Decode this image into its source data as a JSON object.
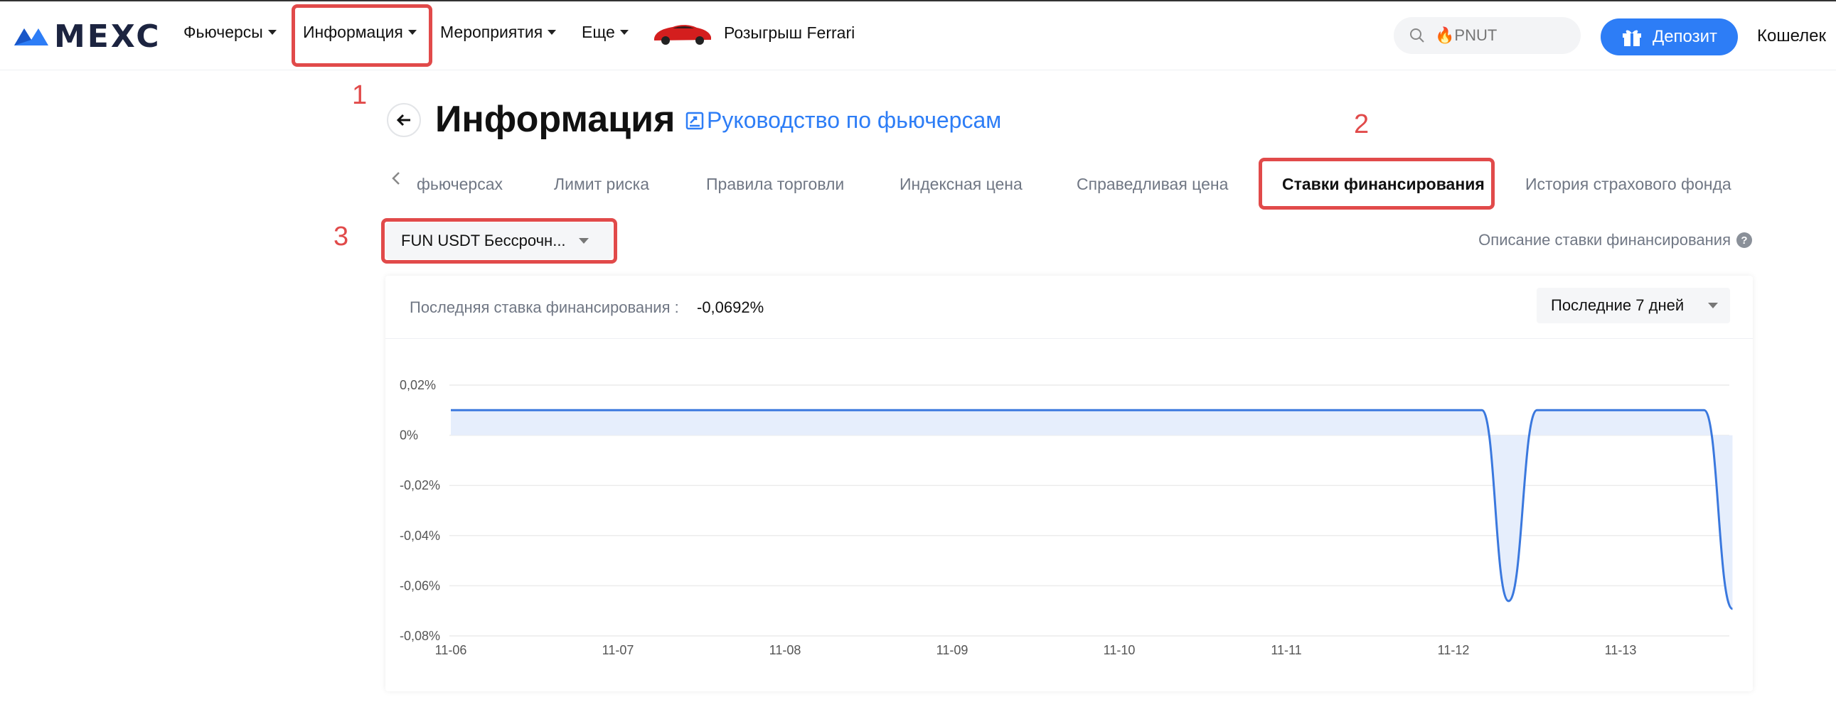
{
  "header": {
    "logo_text": "MEXC",
    "nav": [
      {
        "label": "Фьючерсы"
      },
      {
        "label": "Информация"
      },
      {
        "label": "Мероприятия"
      },
      {
        "label": "Еще"
      },
      {
        "label": "Розыгрыш Ferrari"
      }
    ],
    "search_placeholder": "🔥PNUT",
    "deposit_label": "Депозит",
    "wallet_label": "Кошелек"
  },
  "annotations": [
    "1",
    "2",
    "3"
  ],
  "page": {
    "title": "Информация",
    "guide_link": "Руководство по фьючерсам"
  },
  "tabs": [
    {
      "label": "фьючерсах"
    },
    {
      "label": "Лимит риска"
    },
    {
      "label": "Правила торговли"
    },
    {
      "label": "Индексная цена"
    },
    {
      "label": "Справедливая цена"
    },
    {
      "label": "Ставки финансирования",
      "active": true
    },
    {
      "label": "История страхового фонда"
    }
  ],
  "selector_value": "FUN USDT Бессрочн...",
  "description_link": "Описание ставки финансирования",
  "card": {
    "last_rate_label": "Последняя ставка финансирования :",
    "last_rate_value": "-0,0692%",
    "period_label": "Последние 7 дней"
  },
  "colors": {
    "accent": "#2d7df6",
    "annotation": "#e14a4a",
    "line": "#3a78de",
    "area": "#e6eefc"
  },
  "chart_data": {
    "type": "area",
    "ylim": [
      -0.08,
      0.02
    ],
    "y_ticks": [
      0.02,
      0,
      -0.02,
      -0.04,
      -0.06,
      -0.08
    ],
    "y_tick_labels": [
      "0,02%",
      "0%",
      "-0,02%",
      "-0,04%",
      "-0,06%",
      "-0,08%"
    ],
    "x_ticks": [
      0,
      1,
      2,
      3,
      4,
      5,
      6,
      7
    ],
    "x_tick_labels": [
      "11-06",
      "11-07",
      "11-08",
      "11-09",
      "11-10",
      "11-11",
      "11-12",
      "11-13"
    ],
    "grid": true,
    "series": [
      {
        "x": [
          0,
          1,
          2,
          3,
          4,
          5,
          6,
          6.17,
          6.33,
          6.5,
          6.67,
          6.83,
          7,
          7.17,
          7.33,
          7.5,
          7.67
        ],
        "y": [
          0.01,
          0.01,
          0.01,
          0.01,
          0.01,
          0.01,
          0.01,
          0.01,
          -0.0661,
          0.01,
          0.01,
          0.01,
          0.01,
          0.01,
          0.01,
          0.01,
          -0.0692
        ]
      }
    ]
  }
}
